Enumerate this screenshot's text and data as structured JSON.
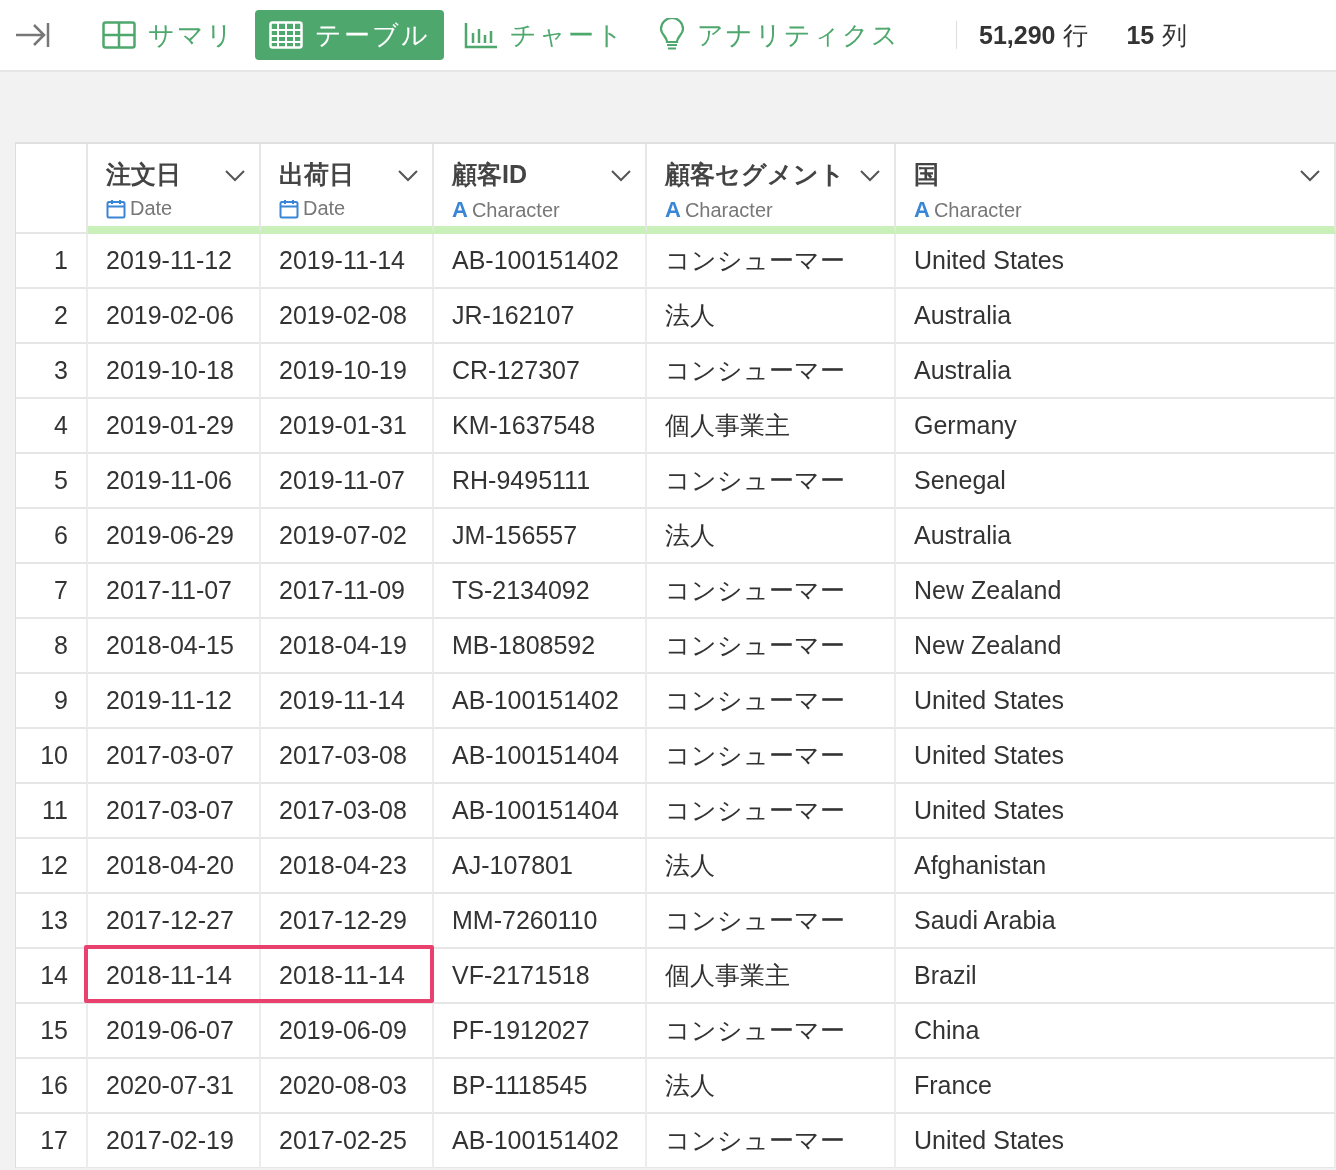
{
  "toolbar": {
    "tabs": [
      {
        "label": "サマリ",
        "kind": "grid",
        "selected": false
      },
      {
        "label": "テーブル",
        "kind": "table",
        "selected": true
      },
      {
        "label": "チャート",
        "kind": "chart",
        "selected": false
      },
      {
        "label": "アナリティクス",
        "kind": "bulb",
        "selected": false
      }
    ],
    "row_count": "51,290",
    "row_unit": "行",
    "column_count": "15",
    "column_unit": "列"
  },
  "table": {
    "columns": [
      {
        "name": "注文日",
        "kind": "date",
        "type_label": "Date"
      },
      {
        "name": "出荷日",
        "kind": "date",
        "type_label": "Date"
      },
      {
        "name": "顧客ID",
        "kind": "character",
        "type_glyph": "A",
        "type_label": "Character"
      },
      {
        "name": "顧客セグメント",
        "kind": "character",
        "type_glyph": "A",
        "type_label": "Character"
      },
      {
        "name": "国",
        "kind": "character",
        "type_glyph": "A",
        "type_label": "Character"
      }
    ],
    "rows": [
      {
        "number": "1",
        "cells": [
          "2019-11-12",
          "2019-11-14",
          "AB-100151402",
          "コンシューマー",
          "United States"
        ],
        "highlighted": false
      },
      {
        "number": "2",
        "cells": [
          "2019-02-06",
          "2019-02-08",
          "JR-162107",
          "法人",
          "Australia"
        ],
        "highlighted": false
      },
      {
        "number": "3",
        "cells": [
          "2019-10-18",
          "2019-10-19",
          "CR-127307",
          "コンシューマー",
          "Australia"
        ],
        "highlighted": false
      },
      {
        "number": "4",
        "cells": [
          "2019-01-29",
          "2019-01-31",
          "KM-1637548",
          "個人事業主",
          "Germany"
        ],
        "highlighted": false
      },
      {
        "number": "5",
        "cells": [
          "2019-11-06",
          "2019-11-07",
          "RH-9495111",
          "コンシューマー",
          "Senegal"
        ],
        "highlighted": false
      },
      {
        "number": "6",
        "cells": [
          "2019-06-29",
          "2019-07-02",
          "JM-156557",
          "法人",
          "Australia"
        ],
        "highlighted": false
      },
      {
        "number": "7",
        "cells": [
          "2017-11-07",
          "2017-11-09",
          "TS-2134092",
          "コンシューマー",
          "New Zealand"
        ],
        "highlighted": false
      },
      {
        "number": "8",
        "cells": [
          "2018-04-15",
          "2018-04-19",
          "MB-1808592",
          "コンシューマー",
          "New Zealand"
        ],
        "highlighted": false
      },
      {
        "number": "9",
        "cells": [
          "2019-11-12",
          "2019-11-14",
          "AB-100151402",
          "コンシューマー",
          "United States"
        ],
        "highlighted": false
      },
      {
        "number": "10",
        "cells": [
          "2017-03-07",
          "2017-03-08",
          "AB-100151404",
          "コンシューマー",
          "United States"
        ],
        "highlighted": false
      },
      {
        "number": "11",
        "cells": [
          "2017-03-07",
          "2017-03-08",
          "AB-100151404",
          "コンシューマー",
          "United States"
        ],
        "highlighted": false
      },
      {
        "number": "12",
        "cells": [
          "2018-04-20",
          "2018-04-23",
          "AJ-107801",
          "法人",
          "Afghanistan"
        ],
        "highlighted": false
      },
      {
        "number": "13",
        "cells": [
          "2017-12-27",
          "2017-12-29",
          "MM-7260110",
          "コンシューマー",
          "Saudi Arabia"
        ],
        "highlighted": false
      },
      {
        "number": "14",
        "cells": [
          "2018-11-14",
          "2018-11-14",
          "VF-2171518",
          "個人事業主",
          "Brazil"
        ],
        "highlighted": true
      },
      {
        "number": "15",
        "cells": [
          "2019-06-07",
          "2019-06-09",
          "PF-1912027",
          "コンシューマー",
          "China"
        ],
        "highlighted": false
      },
      {
        "number": "16",
        "cells": [
          "2020-07-31",
          "2020-08-03",
          "BP-1118545",
          "法人",
          "France"
        ],
        "highlighted": false
      },
      {
        "number": "17",
        "cells": [
          "2017-02-19",
          "2017-02-25",
          "AB-100151402",
          "コンシューマー",
          "United States"
        ],
        "highlighted": false
      }
    ]
  }
}
